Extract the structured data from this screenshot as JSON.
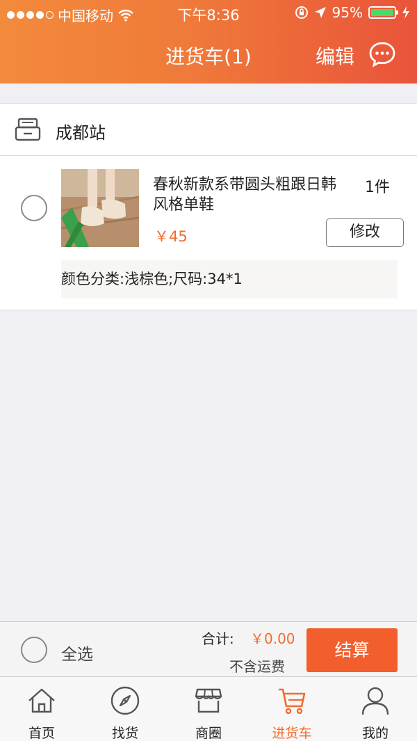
{
  "status_bar": {
    "carrier": "中国移动",
    "time": "下午8:36",
    "battery": "95%"
  },
  "nav": {
    "title": "进货车(1)",
    "edit_label": "编辑"
  },
  "store": {
    "name": "成都站"
  },
  "item": {
    "name": "春秋新款系带圆头粗跟日韩风格单鞋",
    "quantity": "1件",
    "price": "￥45",
    "modify_label": "修改",
    "spec": "颜色分类:浅棕色;尺码:34*1"
  },
  "footer": {
    "select_all_label": "全选",
    "total_label": "合计:",
    "total_value": "￥0.00",
    "shipping_note": "不含运费",
    "checkout_label": "结算"
  },
  "tabs": [
    {
      "label": "首页",
      "icon": "home-icon"
    },
    {
      "label": "找货",
      "icon": "compass-icon"
    },
    {
      "label": "商圈",
      "icon": "shop-icon"
    },
    {
      "label": "进货车",
      "icon": "cart-icon",
      "active": true
    },
    {
      "label": "我的",
      "icon": "user-icon"
    }
  ],
  "colors": {
    "accent": "#f26b2d",
    "header_start": "#f28a3c",
    "header_end": "#e9543a",
    "battery": "#4cd964"
  }
}
